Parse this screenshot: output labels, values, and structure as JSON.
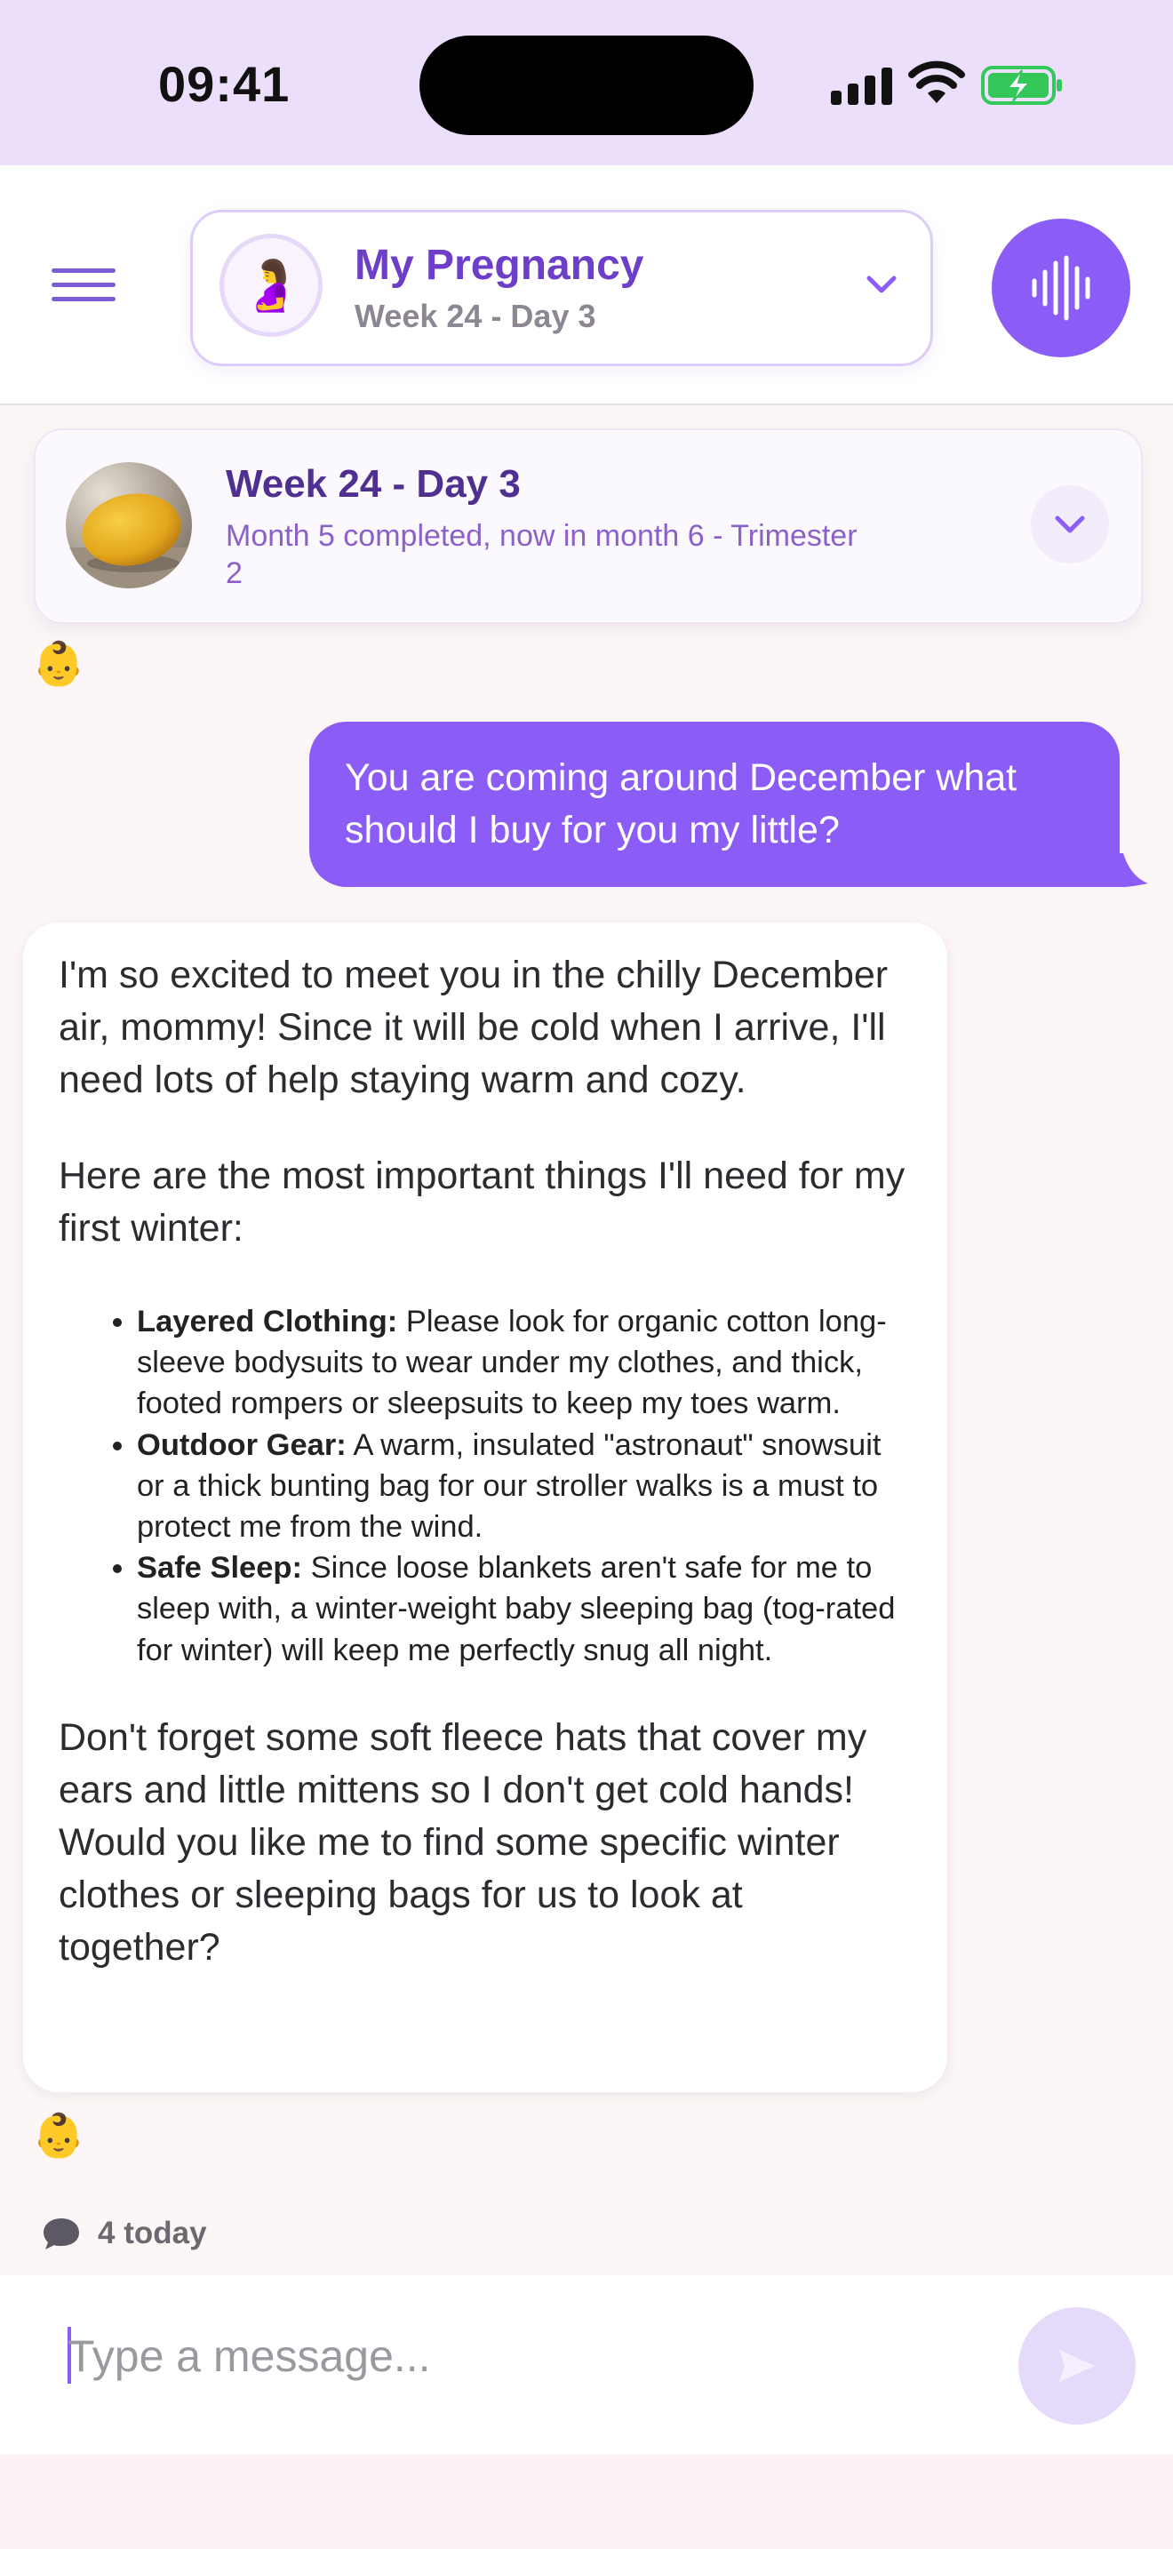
{
  "status_bar": {
    "time": "09:41"
  },
  "header": {
    "pregnancy_selector": {
      "title": "My Pregnancy",
      "subtitle": "Week 24 - Day 3",
      "avatar_emoji": "🤰"
    }
  },
  "week_card": {
    "title": "Week 24 - Day 3",
    "subtitle": "Month 5 completed, now in month 6 - Trimester 2"
  },
  "chat": {
    "baby_emoji": "👶",
    "user_message": "You are coming around December what should I buy for you my little?",
    "assistant_message": {
      "intro": "I'm so excited to meet you in the chilly December air, mommy! Since it will be cold when I arrive, I'll need lots of help staying warm and cozy.",
      "list_intro": "Here are the most important things I'll need for my first winter:",
      "items": [
        {
          "title": "Layered Clothing:",
          "text": " Please look for organic cotton long-sleeve bodysuits to wear under my clothes, and thick, footed rompers or sleepsuits to keep my toes warm."
        },
        {
          "title": "Outdoor Gear:",
          "text": " A warm, insulated \"astronaut\" snowsuit or a thick bunting bag for our stroller walks is a must to protect me from the wind."
        },
        {
          "title": "Safe Sleep:",
          "text": " Since loose blankets aren't safe for me to sleep with, a winter-weight baby sleeping bag (tog-rated for winter) will keep me perfectly snug all night."
        }
      ],
      "outro": "Don't forget some soft fleece hats that cover my ears and little mittens so I don't get cold hands! Would you like me to find some specific winter clothes or sleeping bags for us to look at together?"
    }
  },
  "footer": {
    "message_count": "4 today",
    "input_placeholder": "Type a message..."
  },
  "colors": {
    "accent": "#8b5cf6",
    "title_purple": "#6d3fc8",
    "status_bar_bg": "#ecdffc"
  },
  "icons": [
    "menu-icon",
    "microphone-waveform-icon",
    "chevron-down-icon",
    "chat-bubble-icon",
    "send-icon",
    "signal-icon",
    "wifi-icon",
    "battery-charging-icon"
  ]
}
